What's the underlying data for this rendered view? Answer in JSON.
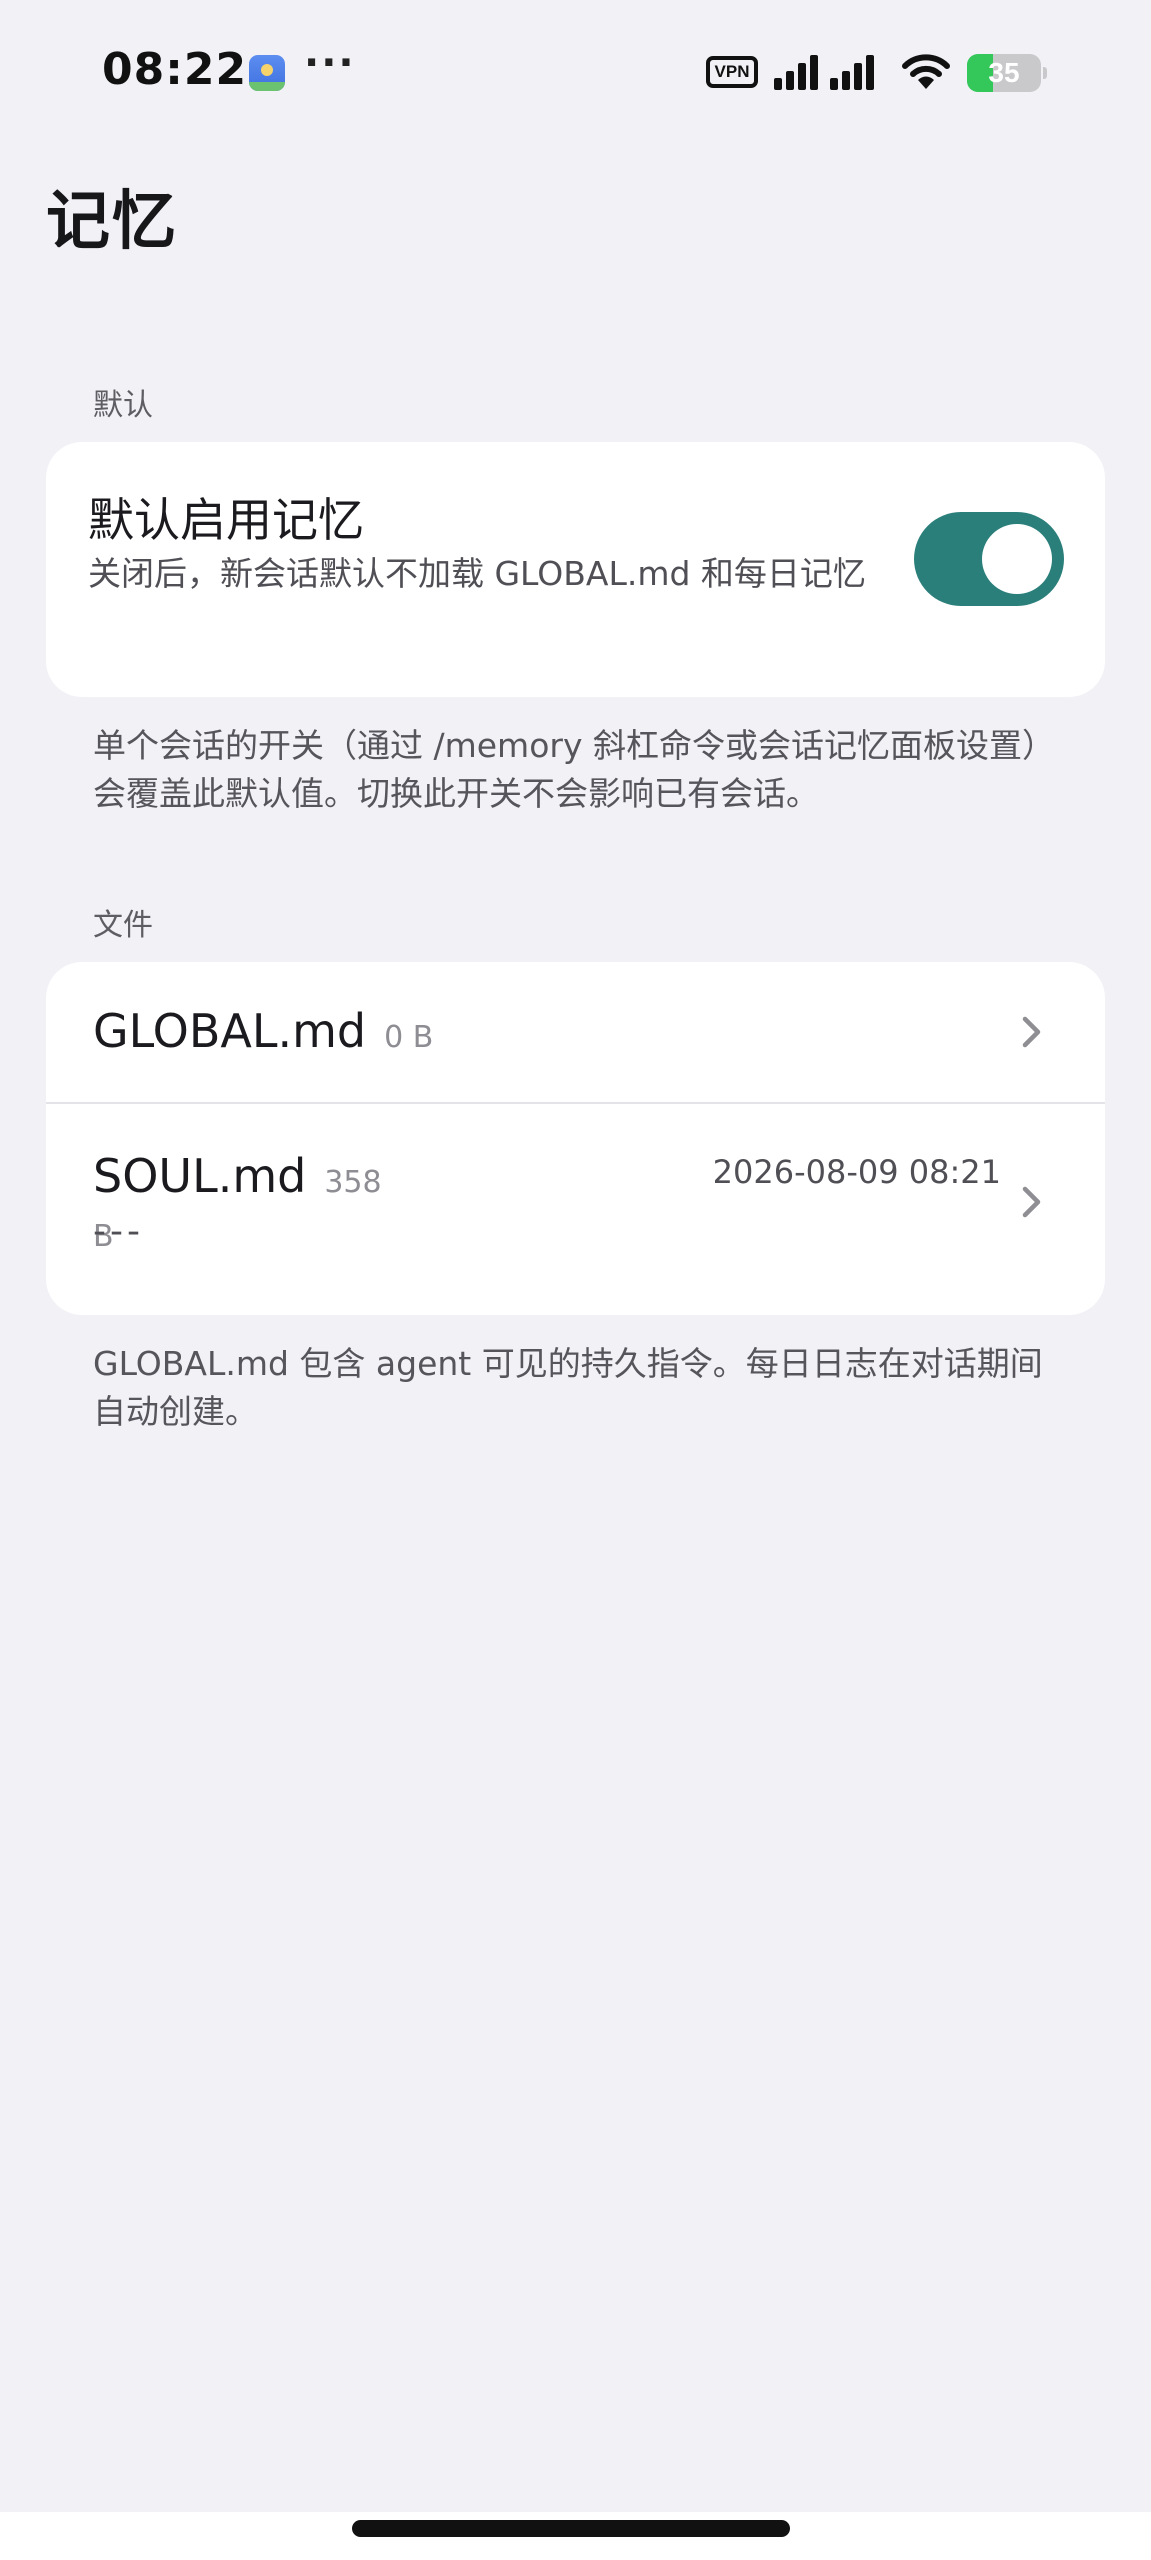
{
  "status_bar": {
    "time": "08:22",
    "more": "···",
    "vpn": "VPN",
    "battery_level": 35,
    "battery_text": "35"
  },
  "page": {
    "title": "记忆"
  },
  "default_section": {
    "header": "默认",
    "toggle_title": "默认启用记忆",
    "toggle_description": "关闭后，新会话默认不加载 GLOBAL.md 和每日记忆",
    "toggle_on": true,
    "footnote": "单个会话的开关（通过 /memory 斜杠命令或会话记忆面板设置）会覆盖此默认值。切换此开关不会影响已有会话。"
  },
  "files_section": {
    "header": "文件",
    "files": [
      {
        "name": "GLOBAL.md",
        "size": "0 B",
        "time": "",
        "preview": ""
      },
      {
        "name": "SOUL.md",
        "size": "358 B",
        "time": "2026-08-09 08:21",
        "preview": "---"
      }
    ],
    "footnote": "GLOBAL.md 包含 agent 可见的持久指令。每日日志在对话期间自动创建。"
  },
  "colors": {
    "background": "#f2f1f6",
    "card": "#ffffff",
    "toggle_on": "#2a7f7a",
    "battery_green": "#34c759"
  }
}
